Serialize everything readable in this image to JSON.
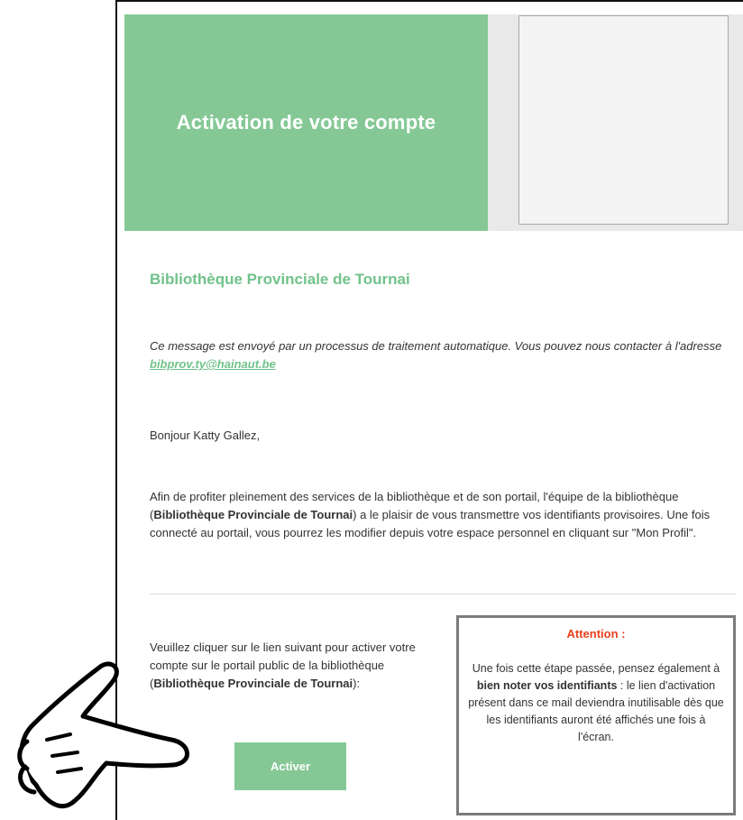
{
  "banner": {
    "title": "Activation de votre compte"
  },
  "library": {
    "name": "Bibliothèque Provinciale de Tournai"
  },
  "notice": {
    "text": "Ce message est envoyé par un processus de traitement automatique. Vous pouvez nous contacter à l'adresse ",
    "email": "bibprov.ty@hainaut.be"
  },
  "greeting": "Bonjour Katty Gallez,",
  "intro": {
    "part1": "Afin de profiter pleinement des services de la bibliothèque et de son portail, l'équipe de la bibliothèque (",
    "bold": "Bibliothèque Provinciale de Tournai",
    "part2": ") a le plaisir de vous transmettre vos identifiants provisoires. Une fois connecté au portail, vous pourrez les modifier depuis votre espace personnel en cliquant sur \"Mon Profil\"."
  },
  "activation": {
    "part1": "Veuillez cliquer sur le lien suivant pour activer votre compte sur le portail public de la bibliothèque (",
    "bold": "Bibliothèque Provinciale de Tournai",
    "part2": "):",
    "button_label": "Activer"
  },
  "attention": {
    "title": "Attention :",
    "part1": "Une fois cette étape passée, pensez également à ",
    "bold": "bien noter vos identifiants",
    "part2": " : le lien d'activation présent dans ce mail deviendra inutilisable dès que les identifiants auront été affichés une fois à l'écran."
  },
  "icons": {
    "pointer": "pointing-hand-icon"
  },
  "colors": {
    "accent": "#85c896",
    "link": "#71c28a",
    "warning": "#e8401c"
  }
}
